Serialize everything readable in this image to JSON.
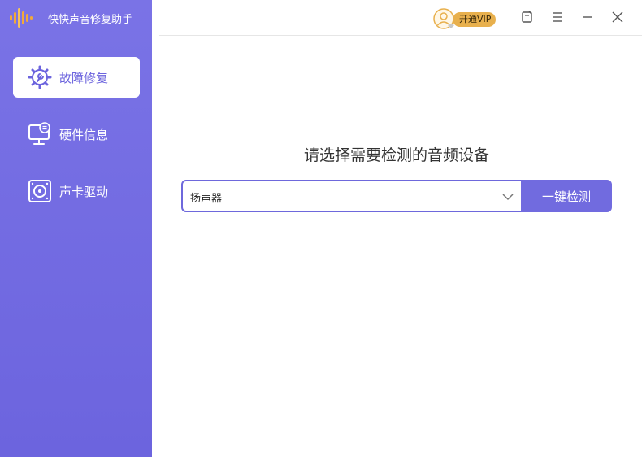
{
  "app": {
    "title": "快快声音修复助手",
    "logo_icon": "sound-wave-logo"
  },
  "sidebar": {
    "items": [
      {
        "label": "故障修复",
        "icon": "gear-wrench-icon",
        "active": true
      },
      {
        "label": "硬件信息",
        "icon": "monitor-info-icon",
        "active": false
      },
      {
        "label": "声卡驱动",
        "icon": "speaker-card-icon",
        "active": false
      }
    ]
  },
  "topbar": {
    "vip_label": "开通VIP",
    "icons": [
      "user-avatar-icon",
      "feedback-icon",
      "menu-icon",
      "minimize-icon",
      "close-icon"
    ]
  },
  "main": {
    "headline": "请选择需要检测的音频设备",
    "device_select": {
      "selected": "扬声器"
    },
    "detect_button": "一键检测"
  },
  "colors": {
    "sidebar_bg": "#7a73e6",
    "accent": "#716bdf",
    "vip_gold": "#e8b04d",
    "logo_orange": "#f2a93b"
  }
}
